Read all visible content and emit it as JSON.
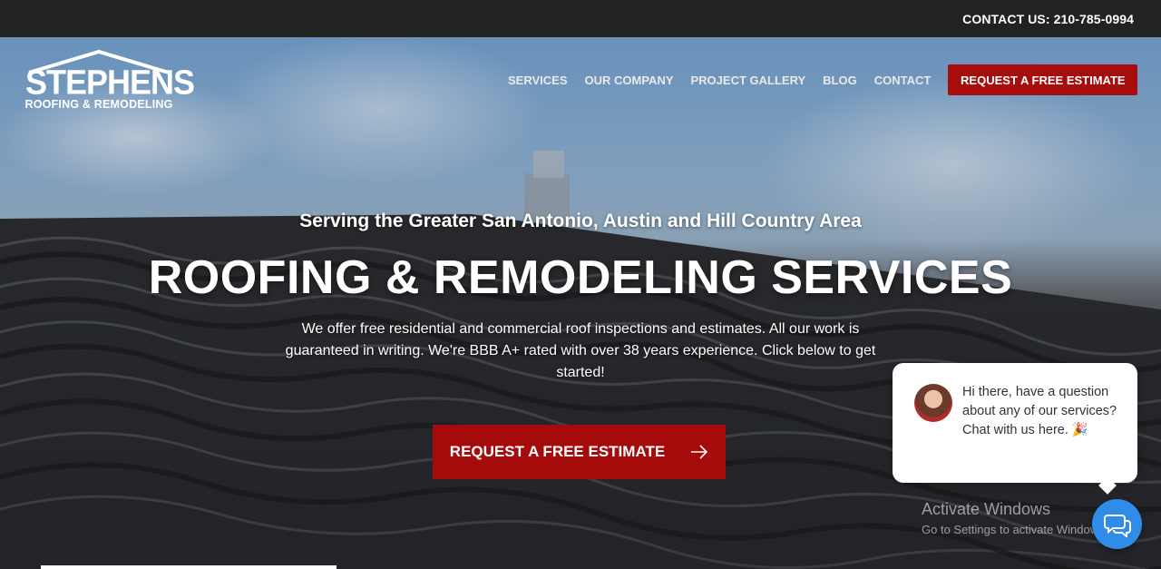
{
  "topbar": {
    "contact": "CONTACT US: 210-785-0994"
  },
  "logo": {
    "brand": "STEPHENS",
    "tagline": "ROOFING & REMODELING"
  },
  "nav": {
    "items": [
      {
        "label": "SERVICES"
      },
      {
        "label": "OUR COMPANY"
      },
      {
        "label": "PROJECT GALLERY"
      },
      {
        "label": "BLOG"
      },
      {
        "label": "CONTACT"
      }
    ],
    "cta": "REQUEST A FREE ESTIMATE"
  },
  "hero": {
    "subtitle": "Serving the Greater San Antonio, Austin and Hill Country Area",
    "headline": "ROOFING & REMODELING SERVICES",
    "description": "We offer free residential and commercial roof inspections and estimates. All our work is guaranteed in writing. We're BBB A+ rated with over 38 years experience. Click below to get started!",
    "cta": "REQUEST A FREE ESTIMATE"
  },
  "chat": {
    "message": "Hi there, have a question about any of our services? Chat with us here.",
    "emoji": "🎉"
  },
  "watermark": {
    "line1": "Activate Windows",
    "line2": "Go to Settings to activate Windows."
  },
  "colors": {
    "accent_red": "#a80d0d",
    "topbar": "#222222",
    "chat_blue": "#2f8ce8"
  },
  "icons": {
    "cta_arrow": "arrow-right-icon",
    "chat_launcher": "chat-bubbles-icon"
  }
}
